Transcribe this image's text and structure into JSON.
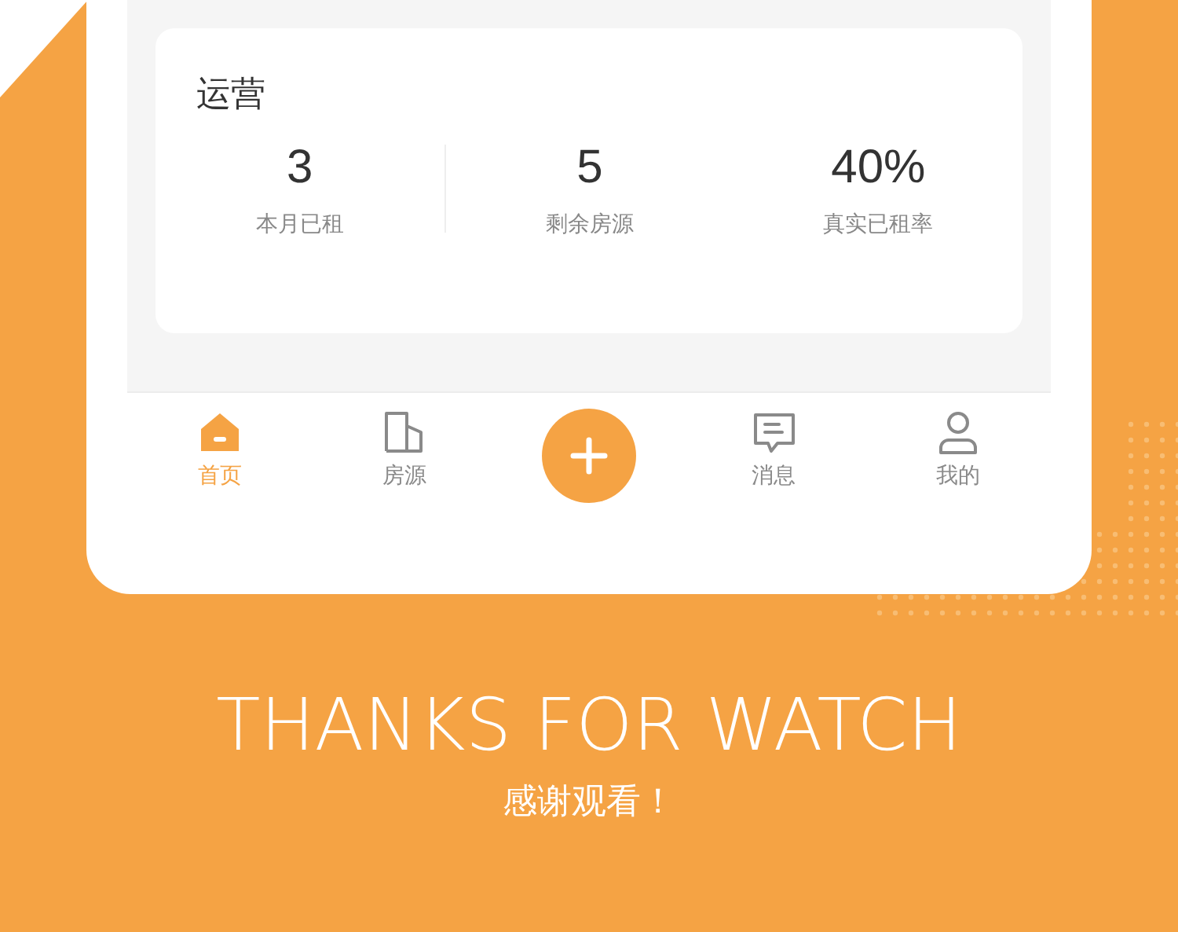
{
  "card": {
    "title": "运营",
    "stats": [
      {
        "value": "3",
        "label": "本月已租"
      },
      {
        "value": "5",
        "label": "剩余房源"
      },
      {
        "value": "40%",
        "label": "真实已租率"
      }
    ]
  },
  "tab_bar": [
    {
      "kind": "home",
      "label": "首页",
      "selected": true
    },
    {
      "kind": "building",
      "label": "房源",
      "selected": false
    },
    {
      "kind": "add"
    },
    {
      "kind": "message",
      "label": "消息",
      "selected": false
    },
    {
      "kind": "person",
      "label": "我的",
      "selected": false
    }
  ],
  "footer": {
    "title": "THANKS FOR WATCH",
    "subtitle": "感谢观看！"
  }
}
